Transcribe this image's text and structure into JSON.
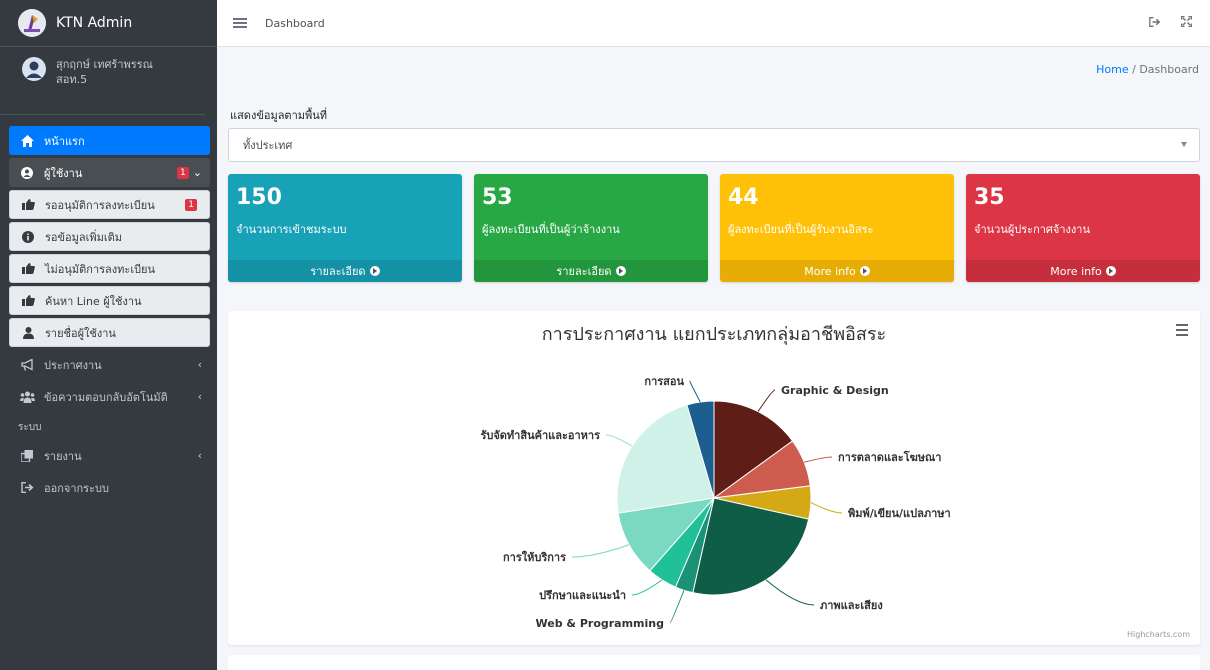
{
  "brand": {
    "name": "KTN Admin"
  },
  "user": {
    "name": "สุกฤกษ์ เทศร้าพรรณ",
    "org": "สอท.5"
  },
  "nav": {
    "items": [
      {
        "label": "หน้าแรก",
        "icon": "home-icon"
      },
      {
        "label": "ผู้ใช้งาน",
        "icon": "user-circle-icon",
        "badge": "1"
      },
      {
        "label": "รออนุมัติการลงทะเบียน",
        "icon": "thumbs-up-icon",
        "badge": "1"
      },
      {
        "label": "รอข้อมูลเพิ่มเติม",
        "icon": "info-icon"
      },
      {
        "label": "ไม่อนุมัติการลงทะเบียน",
        "icon": "thumbs-up-icon"
      },
      {
        "label": "ค้นหา Line ผู้ใช้งาน",
        "icon": "thumbs-up-icon"
      },
      {
        "label": "รายชื่อผู้ใช้งาน",
        "icon": "user-icon"
      },
      {
        "label": "ประกาศงาน",
        "icon": "bullhorn-icon"
      },
      {
        "label": "ข้อความตอบกลับอัตโนมัติ",
        "icon": "users-icon"
      },
      {
        "label": "รายงาน",
        "icon": "clone-icon"
      },
      {
        "label": "ออกจากระบบ",
        "icon": "sign-out-icon"
      }
    ],
    "section_header": "ระบบ"
  },
  "topbar": {
    "link": "Dashboard"
  },
  "breadcrumb": {
    "home": "Home",
    "separator": "/",
    "current": "Dashboard"
  },
  "filter": {
    "label": "แสดงข้อมูลตามพื้นที่",
    "value": "ทั้งประเทศ"
  },
  "stats": [
    {
      "value": "150",
      "label": "จำนวนการเข้าชมระบบ",
      "more": "รายละเอียด",
      "color": "#17a2b8"
    },
    {
      "value": "53",
      "label": "ผู้ลงทะเบียนที่เป็นผู้ว่าจ้างงาน",
      "more": "รายละเอียด",
      "color": "#28a745"
    },
    {
      "value": "44",
      "label": "ผู้ลงทะเบียนที่เป็นผู้รับงานอิสระ",
      "more": "More info",
      "color": "#ffc107"
    },
    {
      "value": "35",
      "label": "จำนวนผู้ประกาศจ้างงาน",
      "more": "More info",
      "color": "#dc3545"
    }
  ],
  "chart_card": {
    "credits": "Highcharts.com"
  },
  "chart_data": {
    "type": "pie",
    "title": "การประกาศงาน แยกประเภทกลุ่มอาชีพอิสระ",
    "slices": [
      {
        "label": "Graphic & Design",
        "value": 15,
        "color": "#5e1e17"
      },
      {
        "label": "การตลาดและโฆษณา",
        "value": 8,
        "color": "#cd5c4f"
      },
      {
        "label": "พิมพ์/เขียน/แปลภาษา",
        "value": 5.5,
        "color": "#d4a915"
      },
      {
        "label": "ภาพและเสียง",
        "value": 25,
        "color": "#0f5c47"
      },
      {
        "label": "Web & Programming",
        "value": 3,
        "color": "#199276"
      },
      {
        "label": "ปรึกษาและแนะนำ",
        "value": 5,
        "color": "#20c199"
      },
      {
        "label": "การให้บริการ",
        "value": 11,
        "color": "#79d9c1"
      },
      {
        "label": "รับจัดทำสินค้าและอาหาร",
        "value": 23,
        "color": "#cff1e8"
      },
      {
        "label": "การสอน",
        "value": 4.5,
        "color": "#1b5e8f"
      }
    ]
  }
}
